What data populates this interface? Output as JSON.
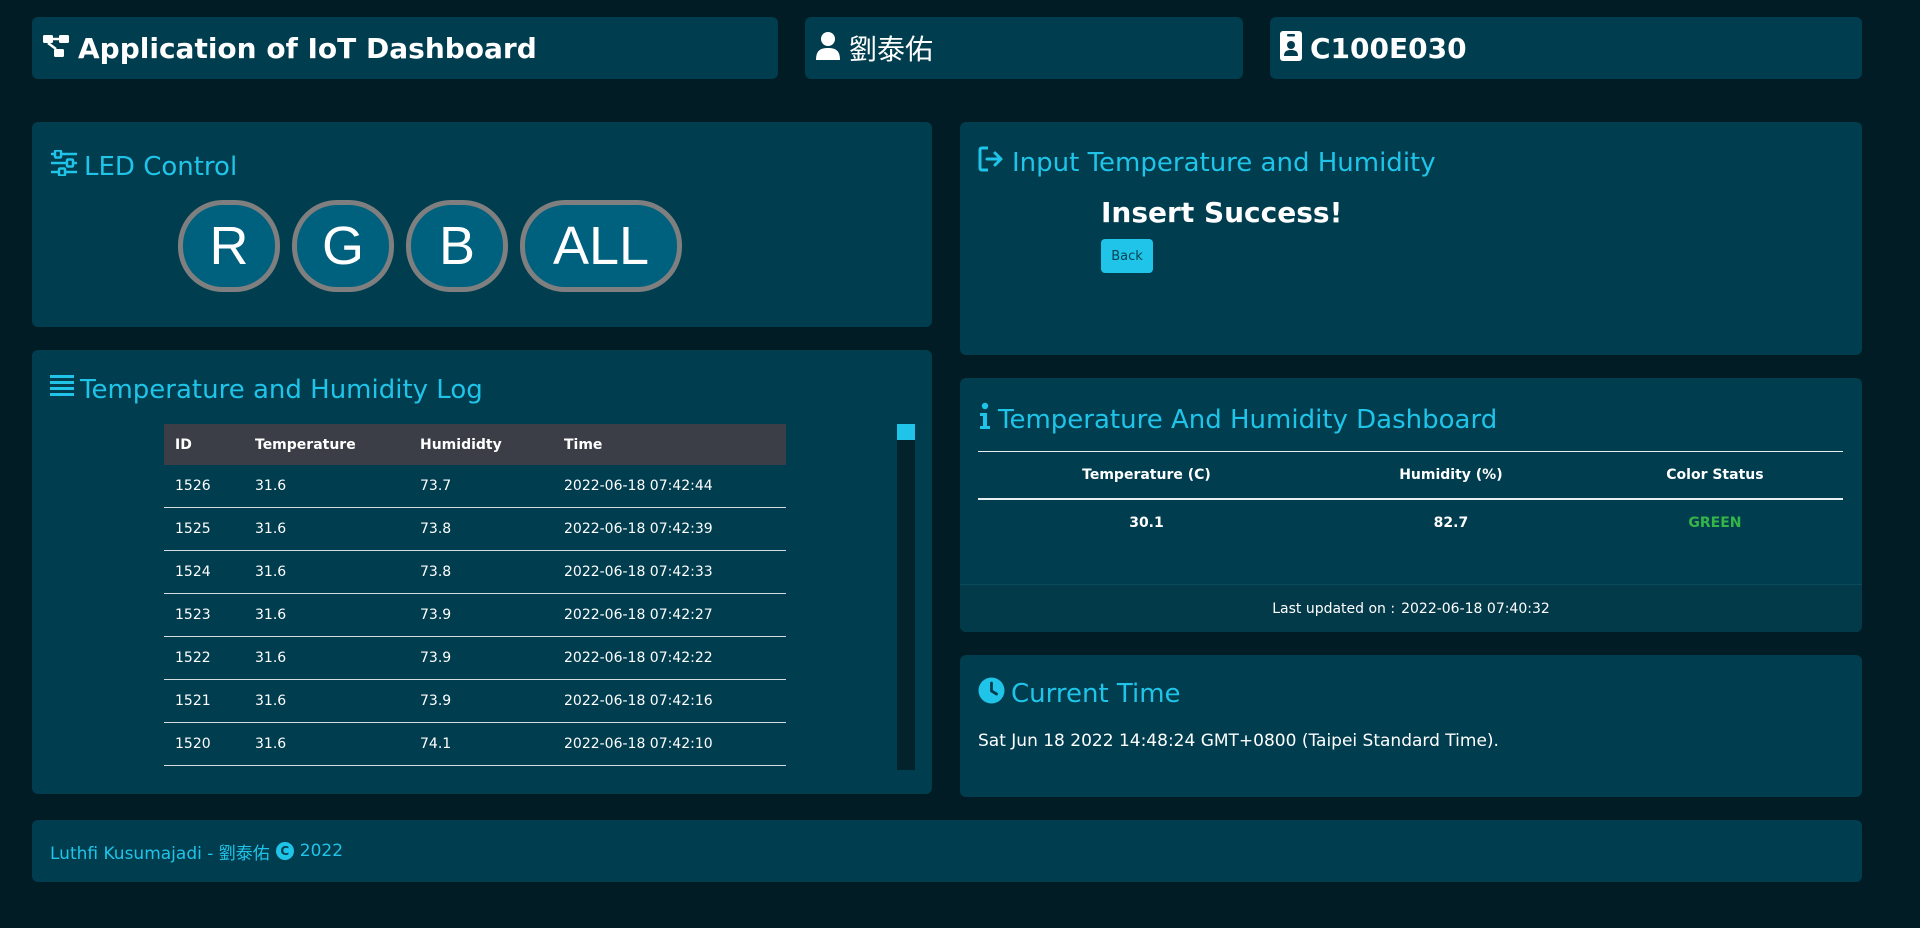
{
  "header": {
    "app_title": "Application of IoT Dashboard",
    "user_name": "劉泰佑",
    "student_id": "C100E030"
  },
  "led_control": {
    "title": "LED Control",
    "buttons": [
      "R",
      "G",
      "B",
      "ALL"
    ]
  },
  "log": {
    "title": "Temperature and Humidity Log",
    "columns": [
      "ID",
      "Temperature",
      "Humididty",
      "Time"
    ],
    "rows": [
      [
        "1526",
        "31.6",
        "73.7",
        "2022-06-18 07:42:44"
      ],
      [
        "1525",
        "31.6",
        "73.8",
        "2022-06-18 07:42:39"
      ],
      [
        "1524",
        "31.6",
        "73.8",
        "2022-06-18 07:42:33"
      ],
      [
        "1523",
        "31.6",
        "73.9",
        "2022-06-18 07:42:27"
      ],
      [
        "1522",
        "31.6",
        "73.9",
        "2022-06-18 07:42:22"
      ],
      [
        "1521",
        "31.6",
        "73.9",
        "2022-06-18 07:42:16"
      ],
      [
        "1520",
        "31.6",
        "74.1",
        "2022-06-18 07:42:10"
      ]
    ]
  },
  "input": {
    "title": "Input Temperature and Humidity",
    "message": "Insert Success!",
    "back_label": "Back"
  },
  "dashboard": {
    "title": "Temperature And Humidity Dashboard",
    "columns": [
      "Temperature (C)",
      "Humidity (%)",
      "Color Status"
    ],
    "values": [
      "30.1",
      "82.7",
      "GREEN"
    ],
    "last_updated_label": "Last updated on :",
    "last_updated_value": "2022-06-18 07:40:32"
  },
  "current_time": {
    "title": "Current Time",
    "text": "Sat Jun 18 2022 14:48:24 GMT+0800 (Taipei Standard Time)."
  },
  "footer": {
    "author": "Luthfi Kusumajadi - 劉泰佑",
    "year": "2022"
  },
  "colors": {
    "background": "#021c25",
    "card": "#003d4f",
    "accent": "#1fc4e8",
    "status_green": "#34b548"
  }
}
